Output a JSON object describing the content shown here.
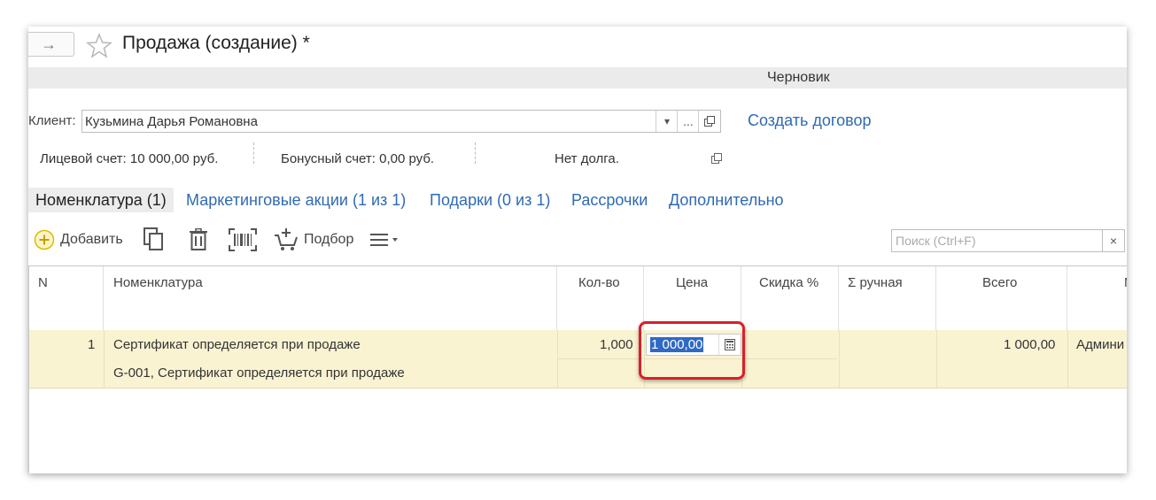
{
  "header": {
    "title": "Продажа (создание) *",
    "status": "Черновик"
  },
  "client": {
    "label": "Клиент:",
    "value": "Кузьмина Дарья Романовна",
    "select_btn": "...",
    "create_contract": "Создать договор"
  },
  "info": {
    "account": "Лицевой счет: 10 000,00  руб.",
    "bonus": "Бонусный счет: 0,00  руб.",
    "debt": "Нет долга."
  },
  "tabs": [
    {
      "label": "Номенклатура (1)",
      "active": true
    },
    {
      "label": "Маркетинговые акции (1 из 1)"
    },
    {
      "label": "Подарки (0 из 1)"
    },
    {
      "label": "Рассрочки"
    },
    {
      "label": "Дополнительно"
    }
  ],
  "toolbar": {
    "add_label": "Добавить",
    "pick_label": "Подбор",
    "search_placeholder": "Поиск (Ctrl+F)",
    "search_clear": "×"
  },
  "table": {
    "columns": [
      "N",
      "Номенклатура",
      "Кол-во",
      "Цена",
      "Скидка %",
      "Σ ручная",
      "Всего",
      "М"
    ],
    "rows": [
      {
        "n": "1",
        "name": "Сертификат определяется при продаже",
        "subtitle": "G-001, Сертификат определяется при продаже",
        "qty": "1,000",
        "price": "1 000,00",
        "discount": "",
        "manual_sum": "",
        "total": "1 000,00",
        "manager": "Админи"
      }
    ]
  },
  "colors": {
    "accent_link": "#2e6ab3",
    "row_highlight": "#faf3d2",
    "selection": "#3069c4",
    "callout": "#d8202b"
  }
}
